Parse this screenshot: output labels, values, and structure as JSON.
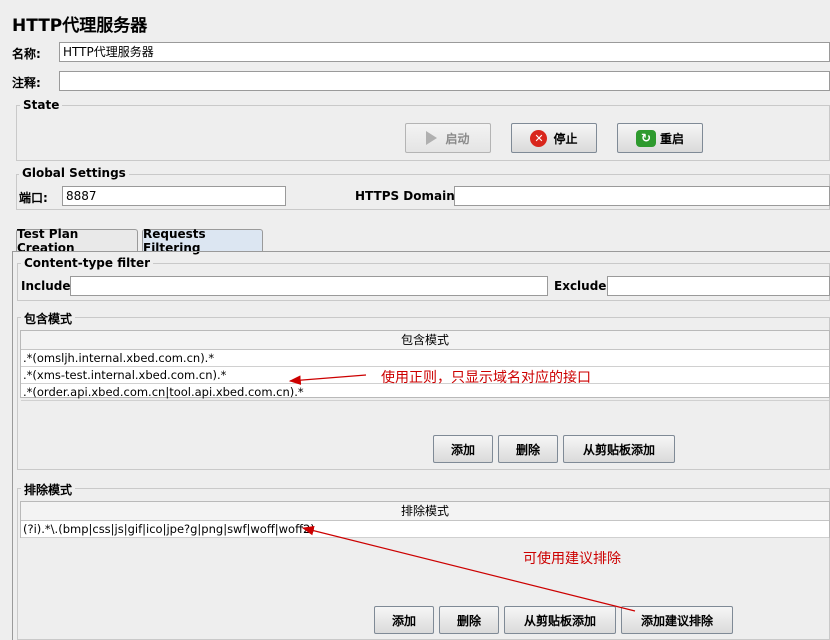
{
  "panel": {
    "title": "HTTP代理服务器",
    "name_label": "名称:",
    "name_value": "HTTP代理服务器",
    "comment_label": "注释:",
    "comment_value": ""
  },
  "state": {
    "title": "State",
    "start_label": "启动",
    "stop_label": "停止",
    "restart_label": "重启"
  },
  "global": {
    "title": "Global Settings",
    "port_label": "端口:",
    "port_value": "8887",
    "https_label": "HTTPS Domains:",
    "https_value": ""
  },
  "tabs": [
    {
      "label": "Test Plan Creation",
      "active": false
    },
    {
      "label": "Requests Filtering",
      "active": true
    }
  ],
  "content_filter": {
    "title": "Content-type filter",
    "include_label": "Include:",
    "include_value": "",
    "exclude_label": "Exclude:",
    "exclude_value": ""
  },
  "include_patterns": {
    "title": "包含模式",
    "header": "包含模式",
    "rows": [
      ".*(omsljh.internal.xbed.com.cn).*",
      ".*(xms-test.internal.xbed.com.cn).*",
      ".*(order.api.xbed.com.cn|tool.api.xbed.com.cn).*"
    ],
    "add_label": "添加",
    "delete_label": "删除",
    "paste_label": "从剪贴板添加"
  },
  "exclude_patterns": {
    "title": "排除模式",
    "header": "排除模式",
    "rows": [
      "(?i).*\\.(bmp|css|js|gif|ico|jpe?g|png|swf|woff|woff2)"
    ],
    "add_label": "添加",
    "delete_label": "删除",
    "paste_label": "从剪贴板添加",
    "suggested_label": "添加建议排除"
  },
  "annotations": {
    "include_note": "使用正则，只显示域名对应的接口",
    "exclude_note": "可使用建议排除"
  },
  "colors": {
    "annotation": "#cc0000",
    "background": "#eeeeee",
    "active_tab": "#dce6f2",
    "stop_icon": "#d9261c",
    "restart_icon": "#2e9a2e"
  }
}
